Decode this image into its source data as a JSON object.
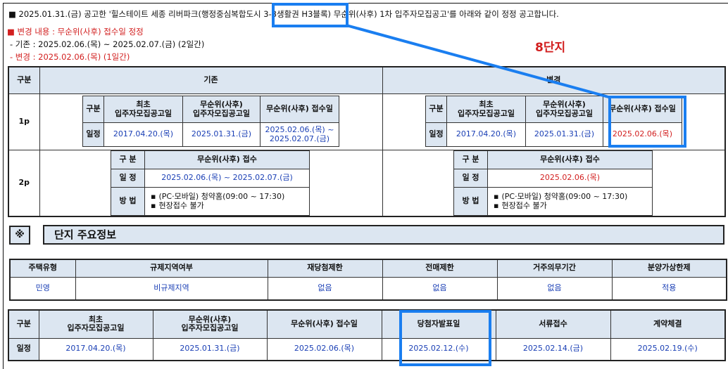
{
  "notice": {
    "line1": "■ 2025.01.31.(금) 공고한 '힐스테이트 세종 리버파크(행정중심복합도시 3-3생활권 H3블록) 무순위(사후) 1차 입주자모집공고'를 아래와 같이 정정 공고합니다.",
    "change_title": "■ 변경 내용 : 무순위(사후) 접수일 정정",
    "before": "- 기존 : 2025.02.06.(목) ~ 2025.02.07.(금) (2일간)",
    "after": "- 변경 : 2025.02.06.(목) (1일간)",
    "annotation": "8단지"
  },
  "compare": {
    "header": {
      "category": "구분",
      "before": "기존",
      "after": "변경"
    },
    "row1_label": "1p",
    "row2_label": "2p",
    "p1": {
      "h_cat": "구분",
      "h_first": "최초\n입주자모집공고일",
      "h_notice": "무순위(사후)\n입주자모집공고일",
      "h_receipt": "무순위(사후) 접수일",
      "r_label": "일정",
      "before": {
        "first": "2017.04.20.(목)",
        "notice": "2025.01.31.(금)",
        "receipt": "2025.02.06.(목) ~\n2025.02.07.(금)"
      },
      "after": {
        "first": "2017.04.20.(목)",
        "notice": "2025.01.31.(금)",
        "receipt": "2025.02.06.(목)"
      }
    },
    "p2": {
      "h_cat": "구 분",
      "h_receipt": "무순위(사후) 접수",
      "r_schedule": "일 정",
      "r_method": "방 법",
      "before_schedule": "2025.02.06.(목) ~ 2025.02.07.(금)",
      "after_schedule": "2025.02.06.(목)",
      "method1": "(PC·모바일) 청약홈(09:00 ~ 17:30)",
      "method2": "현장접수 불가"
    }
  },
  "section": {
    "mark": "※",
    "title": "단지 주요정보"
  },
  "info": {
    "headers": [
      "주택유형",
      "규제지역여부",
      "재당첨제한",
      "전매제한",
      "거주의무기간",
      "분양가상한제"
    ],
    "values": [
      "민영",
      "비규제지역",
      "없음",
      "없음",
      "없음",
      "적용"
    ]
  },
  "schedule": {
    "headers": [
      "구분",
      "최초\n입주자모집공고일",
      "무순위(사후)\n입주자모집공고일",
      "무순위(사후) 접수일",
      "당첨자발표일",
      "서류접수",
      "계약체결"
    ],
    "row_label": "일정",
    "values": [
      "2017.04.20.(목)",
      "2025.01.31.(금)",
      "2025.02.06.(목)",
      "2025.02.12.(수)",
      "2025.02.14.(금)",
      "2025.02.19.(수)"
    ]
  },
  "colors": {
    "header_bg": "#dce6f1",
    "highlight": "#1a7ef0",
    "red": "#d21f1f",
    "blue": "#1a3fb5"
  }
}
